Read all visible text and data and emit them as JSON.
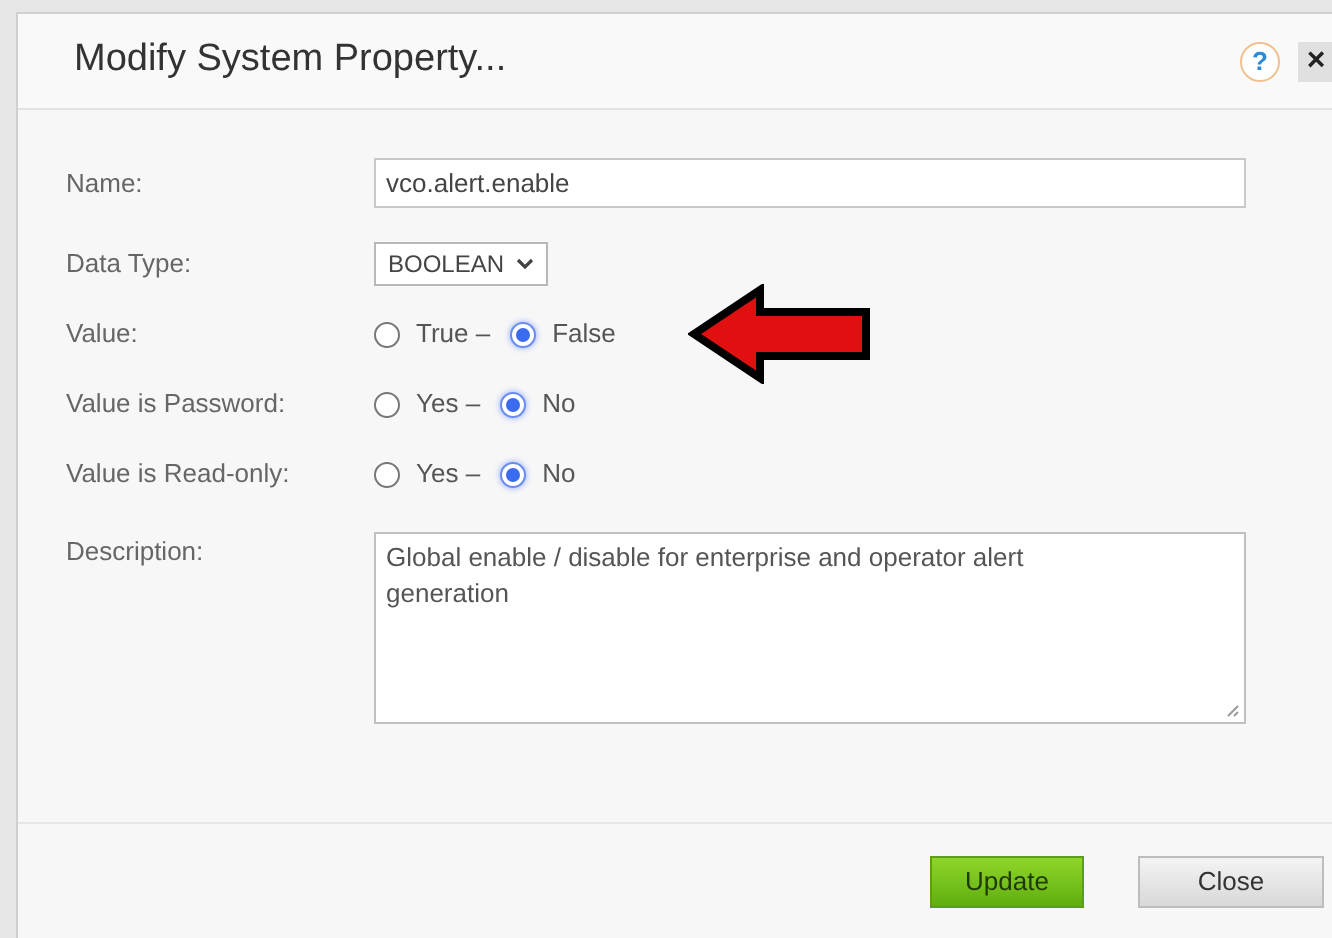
{
  "dialog": {
    "title": "Modify System Property...",
    "help": "?",
    "close": "×"
  },
  "fields": [
    {
      "kind": "text",
      "label": "Name:",
      "value": "vco.alert.enable"
    },
    {
      "kind": "select",
      "label": "Data Type:",
      "value": "BOOLEAN"
    },
    {
      "kind": "radio",
      "label": "Value:",
      "annotated": true,
      "options": [
        {
          "label": "True –",
          "selected": false
        },
        {
          "label": "False",
          "selected": true
        }
      ]
    },
    {
      "kind": "radio",
      "label": "Value is Password:",
      "annotated": false,
      "options": [
        {
          "label": "Yes –",
          "selected": false
        },
        {
          "label": "No",
          "selected": true
        }
      ]
    },
    {
      "kind": "radio",
      "label": "Value is Read-only:",
      "annotated": false,
      "options": [
        {
          "label": "Yes –",
          "selected": false
        },
        {
          "label": "No",
          "selected": true
        }
      ]
    },
    {
      "kind": "textarea",
      "label": "Description:",
      "value": "Global enable / disable for enterprise and operator alert generation"
    }
  ],
  "buttons": [
    {
      "label": "Update",
      "kind": "primary"
    },
    {
      "label": "Close",
      "kind": "secondary"
    }
  ]
}
